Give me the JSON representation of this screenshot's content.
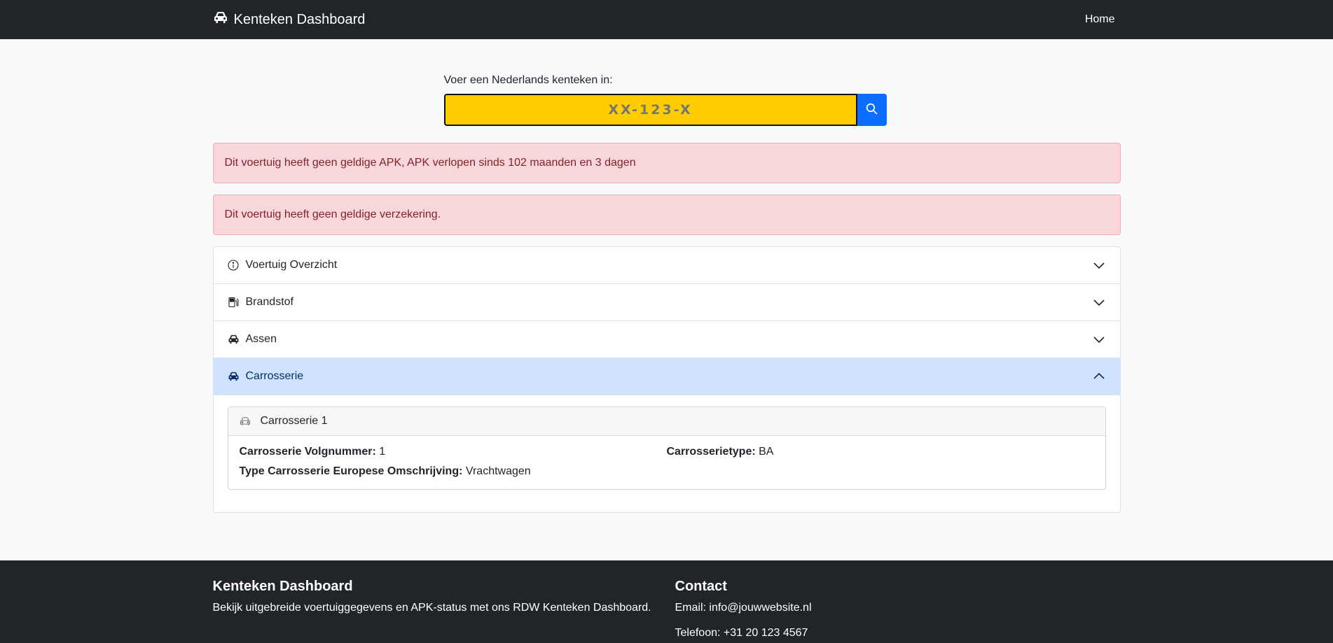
{
  "navbar": {
    "brand": "Kenteken Dashboard",
    "home": "Home"
  },
  "search": {
    "label": "Voer een Nederlands kenteken in:",
    "placeholder": "XX-123-X",
    "plate_color": "#ffcc00"
  },
  "alerts": [
    "Dit voertuig heeft geen geldige APK, APK verlopen sinds 102 maanden en 3 dagen",
    "Dit voertuig heeft geen geldige verzekering."
  ],
  "accordion": {
    "items": [
      {
        "label": "Voertuig Overzicht",
        "icon": "info-icon",
        "expanded": false
      },
      {
        "label": "Brandstof",
        "icon": "fuel-pump-icon",
        "expanded": false
      },
      {
        "label": "Assen",
        "icon": "car-icon",
        "expanded": false
      },
      {
        "label": "Carrosserie",
        "icon": "car-icon",
        "expanded": true
      }
    ],
    "carrosserie_card": {
      "title": "Carrosserie 1",
      "volgnummer_label": "Carrosserie Volgnummer:",
      "volgnummer_value": "1",
      "type_label": "Carrosserietype:",
      "type_value": "BA",
      "omschrijving_label": "Type Carrosserie Europese Omschrijving:",
      "omschrijving_value": "Vrachtwagen"
    }
  },
  "footer": {
    "title": "Kenteken Dashboard",
    "description": "Bekijk uitgebreide voertuiggegevens en APK-status met ons RDW Kenteken Dashboard.",
    "contact_title": "Contact",
    "email": "Email: info@jouwwebsite.nl",
    "phone": "Telefoon: +31 20 123 4567"
  },
  "colors": {
    "navbar": "#212529",
    "primary": "#0d6efd",
    "alert_bg": "#f8d7da",
    "alert_text": "#842029",
    "active_accordion": "#cfe2ff"
  }
}
